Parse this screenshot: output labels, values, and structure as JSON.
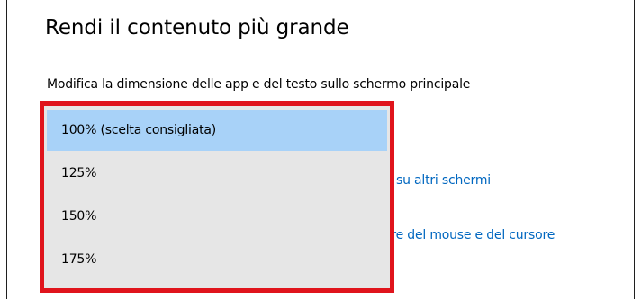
{
  "section": {
    "title": "Rendi il contenuto più grande",
    "description": "Modifica la dimensione delle app e del testo sullo schermo principale"
  },
  "links": [
    {
      "label": "su altri schermi"
    },
    {
      "label": "ore del mouse e del cursore"
    }
  ],
  "scale_dropdown": {
    "selected_index": 0,
    "options": [
      {
        "label": "100% (scelta consigliata)"
      },
      {
        "label": "125%"
      },
      {
        "label": "150%"
      },
      {
        "label": "175%"
      }
    ]
  },
  "colors": {
    "highlight_border": "#e0141c",
    "selected_option_bg": "#a8d2f8",
    "dropdown_bg": "#e6e6e6",
    "link": "#0067c0"
  }
}
